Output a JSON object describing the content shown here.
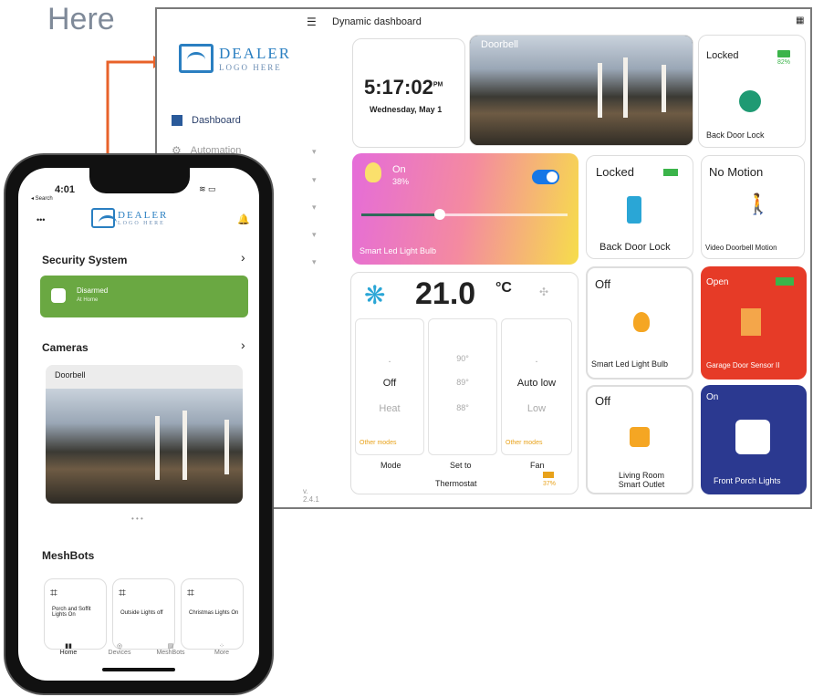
{
  "overlay": {
    "here_text": "Here"
  },
  "dashboard": {
    "menu_icon": "hamburger-icon",
    "title": "Dynamic dashboard",
    "corner_icon": "grid-icon",
    "logo": {
      "line1": "DEALER",
      "line2": "LOGO HERE"
    },
    "sidebar": {
      "items": [
        {
          "label": "Dashboard",
          "icon": "dashboard-icon"
        },
        {
          "label": "Automation",
          "icon": "gear-icon"
        }
      ],
      "version": "v. 2.4.1"
    },
    "clock": {
      "time": "5:17",
      "seconds": ":02",
      "ampm": "PM",
      "date": "Wednesday, May 1"
    },
    "doorbell": {
      "label": "Doorbell"
    },
    "back_lock_top": {
      "status": "Locked",
      "battery": "82%",
      "name": "Back Door Lock"
    },
    "bulb_card": {
      "status": "On",
      "level": "38%",
      "name": "Smart Led Light Bulb",
      "slider_value": 0.38
    },
    "lock_card": {
      "status": "Locked",
      "name": "Back Door Lock"
    },
    "motion_card": {
      "status": "No Motion",
      "name": "Video Doorbell Motion"
    },
    "thermostat": {
      "temp": "21.0",
      "unit": "°C",
      "col1": [
        ".",
        "Off",
        "Heat",
        "Other modes"
      ],
      "col2": [
        "90°",
        "89°",
        "88°"
      ],
      "col3": [
        ".",
        "Auto low",
        "Low",
        "Other modes"
      ],
      "labels": [
        "Mode",
        "Set to",
        "Fan"
      ],
      "name": "Thermostat",
      "battery": "37%"
    },
    "bulb_off": {
      "status": "Off",
      "name": "Smart Led Light Bulb"
    },
    "garage": {
      "status": "Open",
      "name": "Garage Door Sensor II"
    },
    "outlet": {
      "status": "Off",
      "name": "Living Room Smart Outlet"
    },
    "porch": {
      "status": "On",
      "name": "Front Porch Lights"
    },
    "colors": {
      "accent": "#2a7fc1",
      "red": "#e63b27",
      "navy": "#2b3990",
      "green": "#6aa842"
    }
  },
  "phone": {
    "time": "4:01",
    "back_link": "◂ Search",
    "menu_dots": "•••",
    "logo": {
      "line1": "DEALER",
      "line2": "LOGO HERE"
    },
    "security": {
      "title": "Security System",
      "status": "Disarmed",
      "sub": "At Home"
    },
    "cameras": {
      "title": "Cameras",
      "cam_label": "Doorbell"
    },
    "meshbots": {
      "title": "MeshBots",
      "items": [
        "Porch and Soffit Lights On",
        "Outside Lights off",
        "Christmas Lights On"
      ]
    },
    "tabs": [
      "Home",
      "Devices",
      "MeshBots",
      "More"
    ]
  }
}
